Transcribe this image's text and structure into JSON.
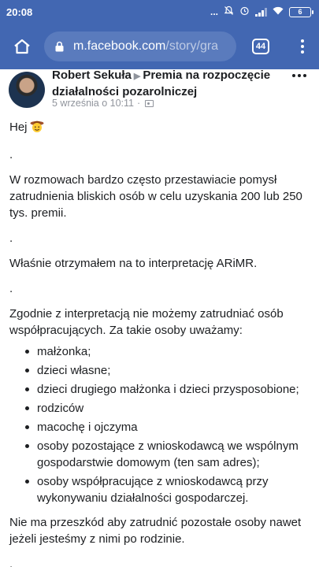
{
  "status_bar": {
    "time": "20:08",
    "dots": "...",
    "battery": "6"
  },
  "browser": {
    "url_main": "m.facebook.com",
    "url_dim": "/story/gra",
    "tab_count": "44",
    "accent_color": "#4267b2"
  },
  "post": {
    "author": "Robert Sekuła",
    "target": "Premia na rozpoczęcie działalności pozarolniczej",
    "date": "5 września o 10:11",
    "meta_sep": "·",
    "greeting": "Hej",
    "separator": ".",
    "paragraph_1": "W rozmowach bardzo często przestawiacie pomysł zatrudnienia bliskich osób w celu uzyskania 200 lub 250 tys. premii.",
    "paragraph_2": "Właśnie otrzymałem na to interpretację ARiMR.",
    "paragraph_3": "Zgodnie z interpretacją nie możemy zatrudniać osób współpracujących. Za takie osoby uważamy:",
    "list_items": [
      "małżonka;",
      "dzieci własne;",
      "dzieci drugiego małżonka i dzieci przysposobione;",
      "rodziców",
      "macochę i ojczyma",
      "osoby pozostające z wnioskodawcą we wspólnym gospodarstwie domowym (ten sam adres);",
      "osoby współpracujące z wnioskodawcą przy wykonywaniu działalności gospodarczej."
    ],
    "paragraph_4": "Nie ma przeszkód aby zatrudnić pozostałe osoby nawet jeżeli jesteśmy z nimi po rodzinie."
  }
}
